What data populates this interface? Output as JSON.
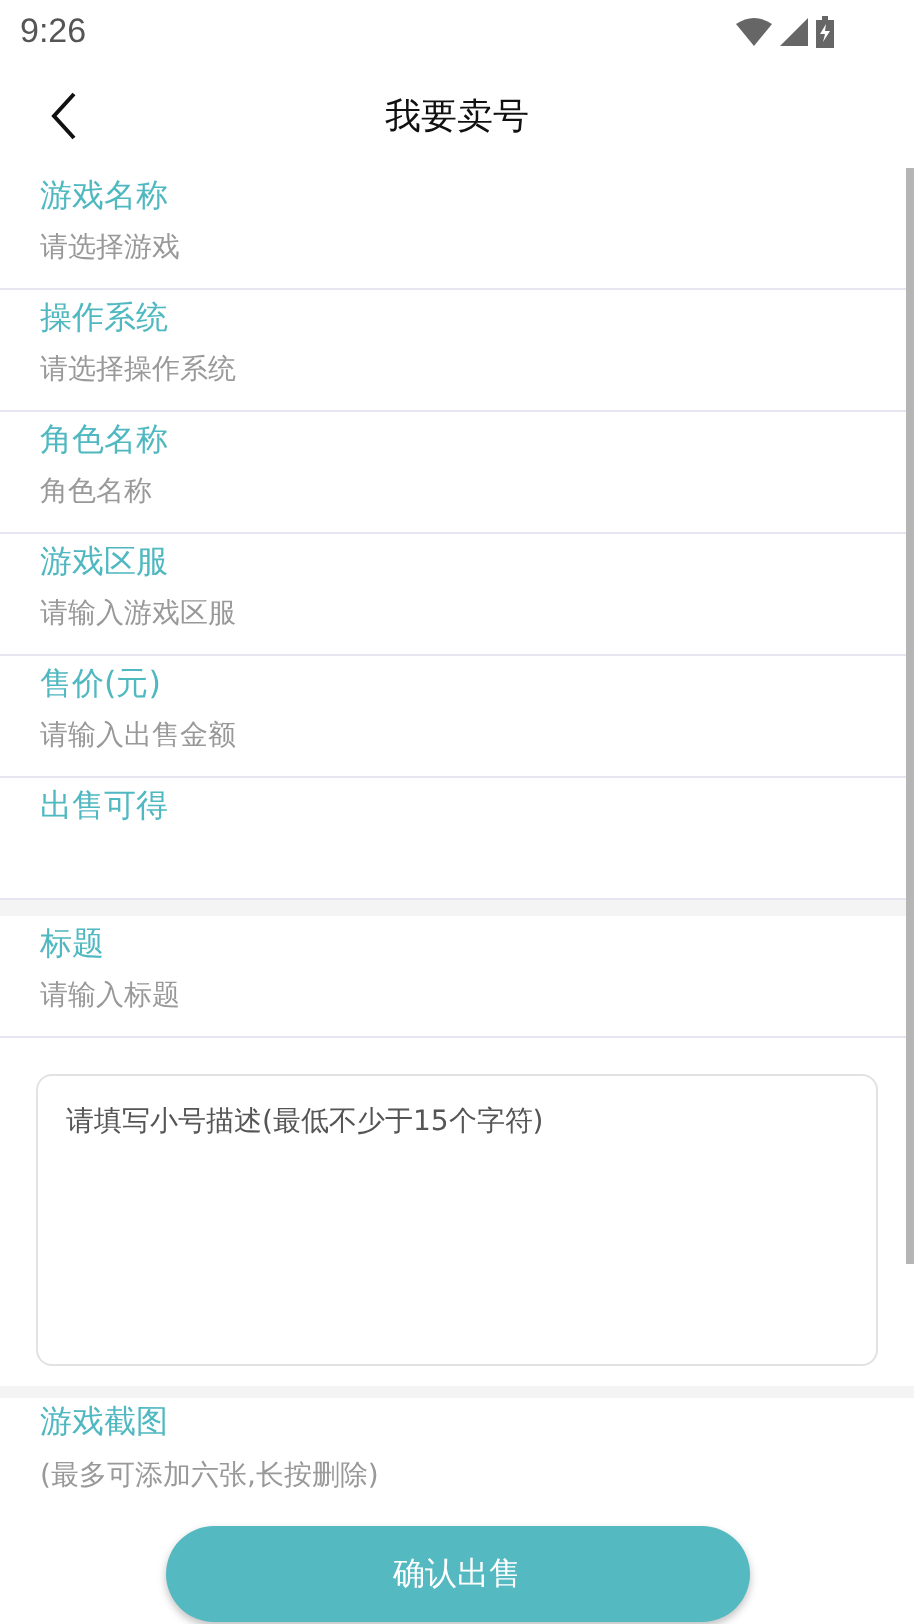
{
  "status_bar": {
    "time": "9:26"
  },
  "header": {
    "title": "我要卖号"
  },
  "fields": [
    {
      "kind": "input",
      "label": "游戏名称",
      "placeholder": "请选择游戏"
    },
    {
      "kind": "input",
      "label": "操作系统",
      "placeholder": "请选择操作系统"
    },
    {
      "kind": "input",
      "label": "角色名称",
      "placeholder": "角色名称"
    },
    {
      "kind": "input",
      "label": "游戏区服",
      "placeholder": "请输入游戏区服"
    },
    {
      "kind": "input",
      "label": "售价(元)",
      "placeholder": "请输入出售金额"
    },
    {
      "kind": "display",
      "label": "出售可得"
    }
  ],
  "title_field": {
    "label": "标题",
    "placeholder": "请输入标题"
  },
  "description": {
    "placeholder": "请填写小号描述(最低不少于15个字符)"
  },
  "screenshots": {
    "label": "游戏截图",
    "hint": "(最多可添加六张,长按删除)"
  },
  "submit_button": "确认出售"
}
